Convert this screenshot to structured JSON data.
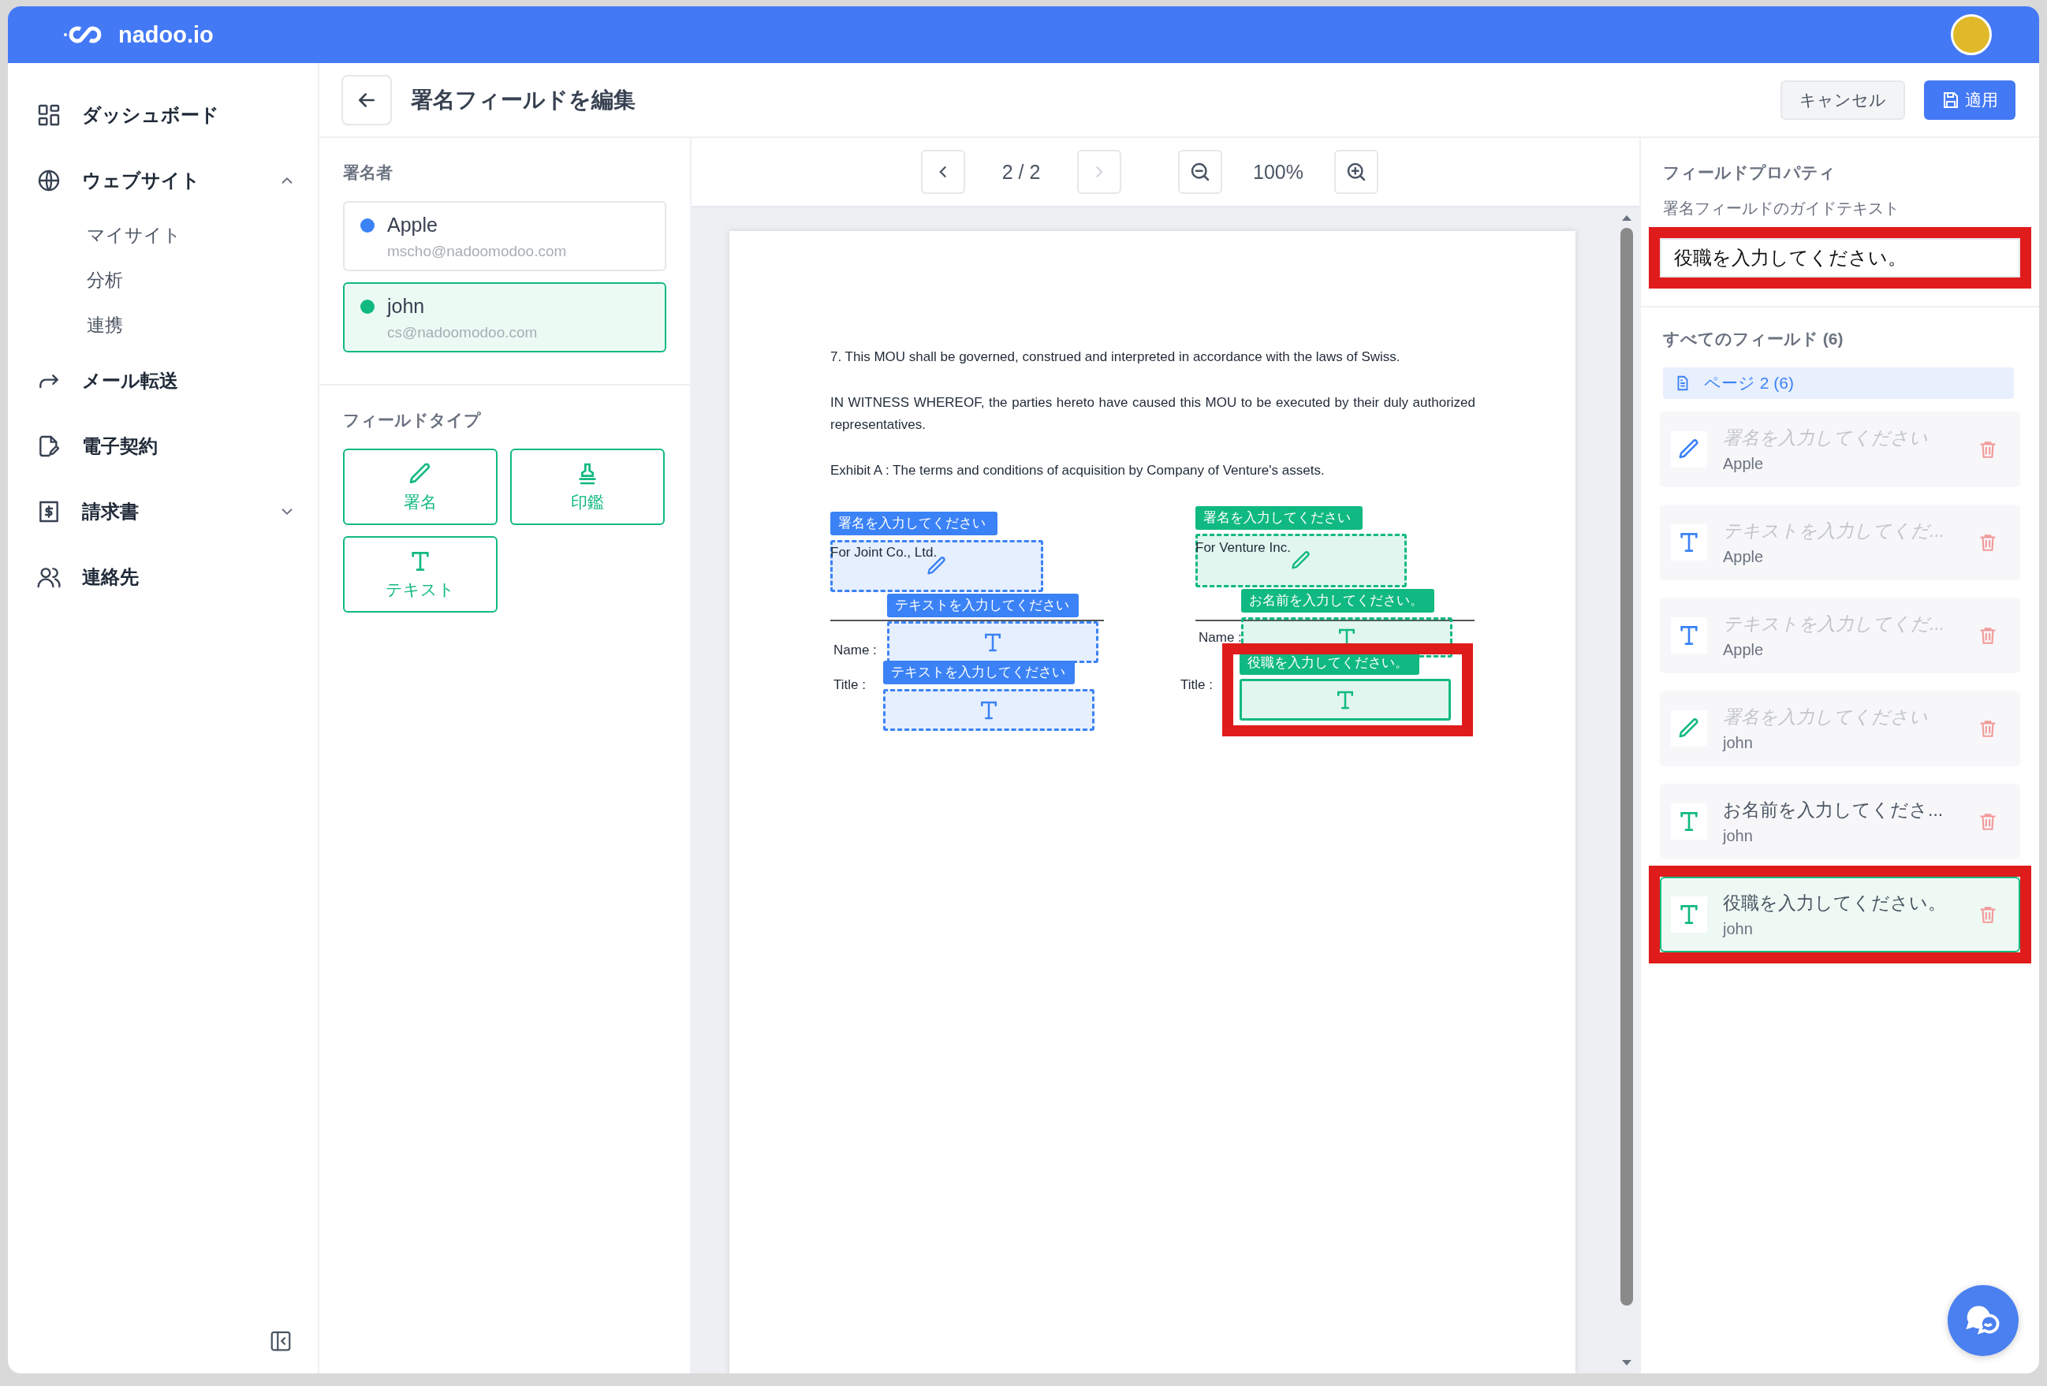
{
  "app": {
    "brand": "nadoo.io"
  },
  "sidebar": {
    "items": [
      {
        "kind": "dashboard",
        "label": "ダッシュボード"
      },
      {
        "kind": "website",
        "label": "ウェブサイト",
        "expanded": true,
        "children": [
          {
            "label": "マイサイト"
          },
          {
            "label": "分析"
          },
          {
            "label": "連携"
          }
        ]
      },
      {
        "kind": "forward",
        "label": "メール転送"
      },
      {
        "kind": "contract",
        "label": "電子契約"
      },
      {
        "kind": "invoice",
        "label": "請求書",
        "expanded": false
      },
      {
        "kind": "contacts",
        "label": "連絡先"
      }
    ]
  },
  "header": {
    "title": "署名フィールドを編集",
    "buttons": [
      {
        "kind": "cancel",
        "label": "キャンセル"
      },
      {
        "kind": "apply",
        "label": "適用"
      }
    ]
  },
  "signers": {
    "heading": "署名者",
    "items": [
      {
        "name": "Apple",
        "email": "mscho@nadoomodoo.com",
        "color": "#3b82f6",
        "selected": false
      },
      {
        "name": "john",
        "email": "cs@nadoomodoo.com",
        "color": "#10b981",
        "selected": true
      }
    ]
  },
  "field_types": {
    "heading": "フィールドタイプ",
    "items": [
      {
        "kind": "signature",
        "label": "署名"
      },
      {
        "kind": "seal",
        "label": "印鑑"
      },
      {
        "kind": "text",
        "label": "テキスト"
      }
    ]
  },
  "viewer": {
    "page": "2 / 2",
    "zoom": "100%",
    "prev_disabled": false,
    "next_disabled": true
  },
  "document": {
    "paragraphs": [
      "7. This MOU shall be governed, construed and interpreted in accordance with the laws of Swiss.",
      "IN WITNESS WHEREOF, the parties hereto have caused this MOU to be executed by their duly authorized representatives.",
      "Exhibit A : The terms and conditions of acquisition by Company of Venture's assets."
    ],
    "parties": [
      {
        "company": "For Joint Co., Ltd.",
        "name_label": "Name :",
        "title_label": "Title :"
      },
      {
        "company": "For Venture Inc.",
        "name_label": "Name :",
        "title_label": "Title :"
      }
    ]
  },
  "doc_fields": [
    {
      "kind": "signature",
      "label": "署名を入力してください",
      "color": "#3b82f6",
      "highlighted": false
    },
    {
      "kind": "text",
      "label": "テキストを入力してください",
      "color": "#3b82f6",
      "highlighted": false
    },
    {
      "kind": "text",
      "label": "テキストを入力してください",
      "color": "#3b82f6",
      "highlighted": false
    },
    {
      "kind": "signature",
      "label": "署名を入力してください",
      "color": "#10b981",
      "highlighted": false
    },
    {
      "kind": "text",
      "label": "お名前を入力してください。",
      "color": "#10b981",
      "highlighted": false
    },
    {
      "kind": "text",
      "label": "役職を入力してください。",
      "color": "#10b981",
      "highlighted": true
    }
  ],
  "properties": {
    "heading": "フィールドプロパティ",
    "guide_label": "署名フィールドのガイドテキスト",
    "guide_value": "役職を入力してください。",
    "highlighted": true
  },
  "all_fields": {
    "heading": "すべてのフィールド (6)",
    "page_group": "ページ 2 (6)",
    "items": [
      {
        "kind": "signature",
        "text": "署名を入力してください",
        "owner": "Apple",
        "color": "#3b82f6",
        "placeholder": true,
        "selected": false,
        "highlighted": false
      },
      {
        "kind": "text",
        "text": "テキストを入力してくだ...",
        "owner": "Apple",
        "color": "#3b82f6",
        "placeholder": true,
        "selected": false,
        "highlighted": false
      },
      {
        "kind": "text",
        "text": "テキストを入力してくだ...",
        "owner": "Apple",
        "color": "#3b82f6",
        "placeholder": true,
        "selected": false,
        "highlighted": false
      },
      {
        "kind": "signature",
        "text": "署名を入力してください",
        "owner": "john",
        "color": "#10b981",
        "placeholder": true,
        "selected": false,
        "highlighted": false
      },
      {
        "kind": "text",
        "text": "お名前を入力してくださ...",
        "owner": "john",
        "color": "#10b981",
        "placeholder": false,
        "selected": false,
        "highlighted": false
      },
      {
        "kind": "text",
        "text": "役職を入力してください。",
        "owner": "john",
        "color": "#10b981",
        "placeholder": false,
        "selected": true,
        "highlighted": true
      }
    ]
  }
}
